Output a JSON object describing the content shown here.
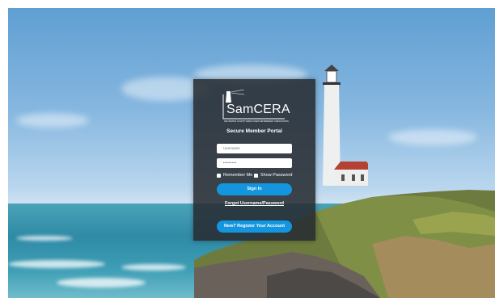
{
  "brand": {
    "logo_text": "SamCERA",
    "logo_tagline": "SAN MATEO COUNTY EMPLOYEES' RETIREMENT ASSOCIATION"
  },
  "portal": {
    "title": "Secure Member Portal"
  },
  "form": {
    "username_placeholder": "Username",
    "password_value": "••••••••",
    "remember_label": "Remember Me",
    "show_password_label": "Show Password",
    "sign_in_label": "Sign In",
    "forgot_link": "Forgot Username/Password",
    "register_label": "New? Register Your Account"
  },
  "colors": {
    "panel": "#2b2f34",
    "primary_button": "#1396df"
  },
  "icons": {
    "logo": "lighthouse-logo-icon"
  }
}
